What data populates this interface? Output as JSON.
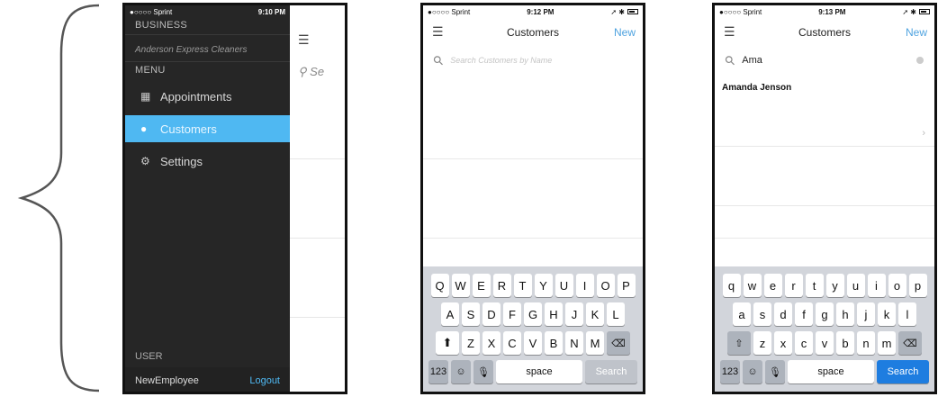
{
  "phone1": {
    "status": {
      "carrier": "●○○○○ Sprint",
      "time": "9:10 PM",
      "icons": "➚ ✱"
    },
    "business_label": "BUSINESS",
    "business_name": "Anderson Express Cleaners",
    "menu_label": "MENU",
    "menu_items": [
      {
        "label": "Appointments",
        "icon": "calendar-icon",
        "glyph": "▦"
      },
      {
        "label": "Customers",
        "icon": "person-icon",
        "glyph": "●"
      },
      {
        "label": "Settings",
        "icon": "gears-icon",
        "glyph": "⚙"
      }
    ],
    "user_label": "USER",
    "user_name": "NewEmployee",
    "logout_label": "Logout",
    "underlay_search": "Se",
    "menu_glyph": "☰",
    "search_glyph": "⚲"
  },
  "phone2": {
    "status": {
      "carrier": "●○○○○ Sprint",
      "time": "9:12 PM",
      "icons": "➚ ✱"
    },
    "title": "Customers",
    "new_label": "New",
    "search_placeholder": "Search Customers by Name",
    "keyboard": {
      "row1": [
        "Q",
        "W",
        "E",
        "R",
        "T",
        "Y",
        "U",
        "I",
        "O",
        "P"
      ],
      "row2": [
        "A",
        "S",
        "D",
        "F",
        "G",
        "H",
        "J",
        "K",
        "L"
      ],
      "row3": [
        "Z",
        "X",
        "C",
        "V",
        "B",
        "N",
        "M"
      ],
      "numbers_label": "123",
      "space_label": "space",
      "action_label": "Search"
    }
  },
  "phone3": {
    "status": {
      "carrier": "●○○○○ Sprint",
      "time": "9:13 PM",
      "icons": "➚ ✱"
    },
    "title": "Customers",
    "new_label": "New",
    "search_value": "Ama",
    "result_name": "Amanda Jenson",
    "keyboard": {
      "row1": [
        "q",
        "w",
        "e",
        "r",
        "t",
        "y",
        "u",
        "i",
        "o",
        "p"
      ],
      "row2": [
        "a",
        "s",
        "d",
        "f",
        "g",
        "h",
        "j",
        "k",
        "l"
      ],
      "row3": [
        "z",
        "x",
        "c",
        "v",
        "b",
        "n",
        "m"
      ],
      "numbers_label": "123",
      "space_label": "space",
      "action_label": "Search"
    }
  },
  "colors": {
    "accent": "#4fb8f2",
    "drawer_bg": "#262626",
    "search_key_active": "#1e7de0"
  }
}
